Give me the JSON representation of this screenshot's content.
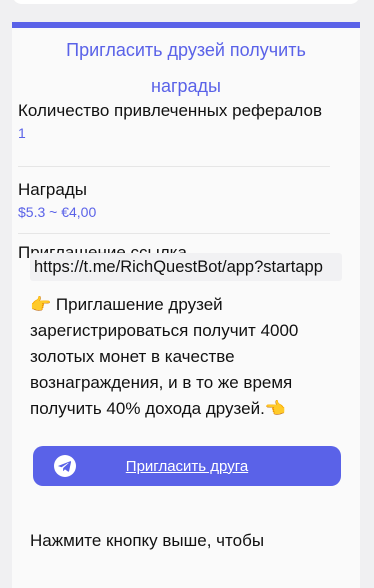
{
  "header": {
    "title": "Пригласить друзей получить награды"
  },
  "stats": [
    {
      "label": "Количество привлеченных рефералов",
      "value": "1"
    },
    {
      "label": "Награды",
      "value": "$5.3 ~ €4,00"
    }
  ],
  "invite": {
    "link_label": "Приглашение ссылка",
    "link_value": "https://t.me/RichQuestBot/app?startapp",
    "promo_emoji_start": "👉",
    "promo_text": "Приглашение друзей зарегистрироваться получит 4000 золотых монет в качестве вознаграждения, и в то же время получить 40% дохода друзей.",
    "promo_emoji_end": "👈",
    "button_label": "Пригласить друга",
    "button_icon": "telegram-icon",
    "footer_text": "Нажмите кнопку выше, чтобы"
  },
  "colors": {
    "accent": "#5a62e8",
    "panel_bg": "#fafafa"
  }
}
